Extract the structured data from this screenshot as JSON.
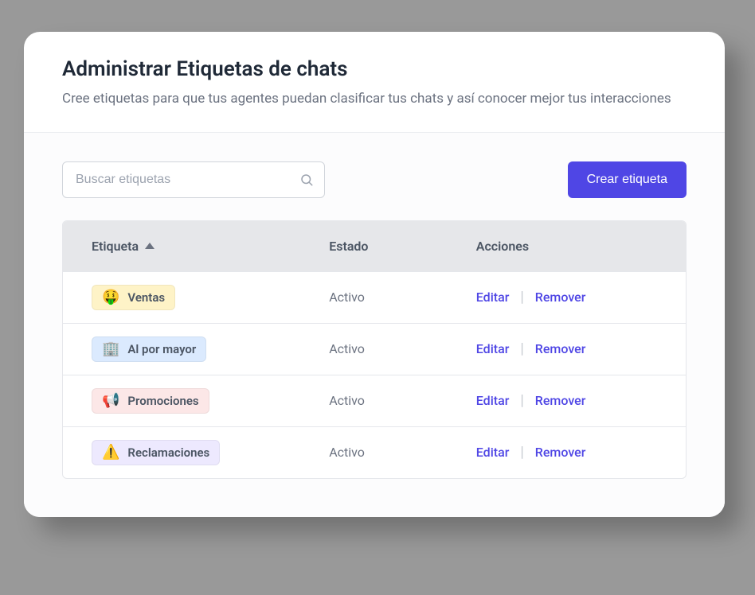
{
  "header": {
    "title": "Administrar Etiquetas de chats",
    "subtitle": "Cree etiquetas para que tus agentes puedan clasificar tus chats y así conocer mejor tus interacciones"
  },
  "toolbar": {
    "search_placeholder": "Buscar etiquetas",
    "create_label": "Crear etiqueta"
  },
  "table": {
    "columns": {
      "label": "Etiqueta",
      "status": "Estado",
      "actions": "Acciones"
    },
    "action_edit": "Editar",
    "action_remove": "Remover",
    "rows": [
      {
        "emoji": "🤑",
        "name": "Ventas",
        "status": "Activo",
        "chip": "chip-yellow"
      },
      {
        "emoji": "🏢",
        "name": "Al por mayor",
        "status": "Activo",
        "chip": "chip-blue"
      },
      {
        "emoji": "📢",
        "name": "Promociones",
        "status": "Activo",
        "chip": "chip-pink"
      },
      {
        "emoji": "⚠️",
        "name": "Reclamaciones",
        "status": "Activo",
        "chip": "chip-purple"
      }
    ]
  }
}
